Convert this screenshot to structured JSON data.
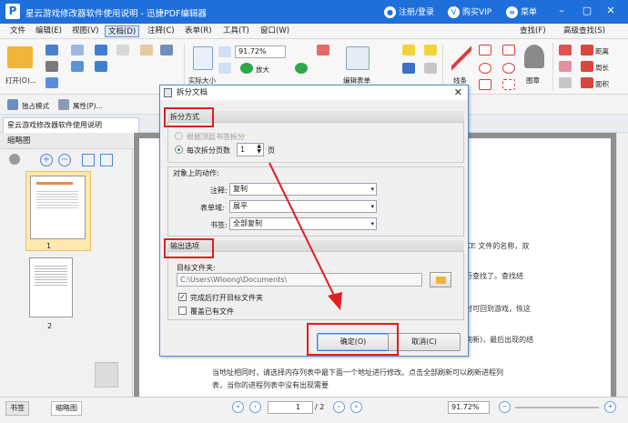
{
  "window": {
    "title": "星云游戏修改器软件使用说明 - 迅捷PDF编辑器",
    "register_label": "注册/登录",
    "buy_label": "购买VIP",
    "menu_label": "菜单"
  },
  "menubar": {
    "items": [
      "文件",
      "编辑(E)",
      "视图(V)",
      "文档(D)",
      "注释(C)",
      "表单(R)",
      "工具(T)",
      "窗口(W)"
    ],
    "active": "文档(D)",
    "right_items": [
      "查找(F)",
      "高级查找(S)"
    ]
  },
  "toolbar": {
    "open_label": "打开(O)...",
    "zoom_value": "91.72%",
    "zoom_in_label": "放大",
    "actual_size_label": "实际大小",
    "edit_form_label": "编辑表单",
    "line_label": "线条",
    "stamp_label": "图章",
    "distance_label": "距离",
    "perimeter_label": "周长",
    "area_label": "面积"
  },
  "toolbar2": {
    "exclusive_mode": "独占模式",
    "properties": "属性(P)..."
  },
  "doc_tab": {
    "label": "星云游戏修改器软件使用说明"
  },
  "left_panel": {
    "title": "缩略图",
    "pages": [
      "1",
      "2"
    ],
    "bottom_tabs": [
      "书签",
      "缩略图"
    ]
  },
  "document": {
    "lines": [
      "KE 文件的名称，双",
      "行查找了。查找结",
      "时可回到游戏，恢这",
      "刷新)，最后出现的结",
      "当地址相同时，请选择内存列表中最下面一个地址进行修改。点击全部刷新可以刷新进程列",
      "表，当你的进程列表中没有出现需要"
    ]
  },
  "statusbar": {
    "page_input": "1",
    "page_total": "/ 2",
    "zoom": "91.72%"
  },
  "dialog": {
    "title": "拆分文档",
    "split_method_header": "拆分方式",
    "option_bookmark": "根据顶层书签拆分",
    "option_pages": "每次拆分页数",
    "pages_value": "1",
    "pages_unit": "页",
    "object_actions_header": "对象上的动作:",
    "annotations_label": "注释:",
    "annotations_value": "复制",
    "form_fields_label": "表单域:",
    "form_fields_value": "展平",
    "bookmarks_label": "书签:",
    "bookmarks_value": "全部复制",
    "output_header": "输出选项",
    "target_folder_label": "目标文件夹:",
    "target_folder_value": "C:\\Users\\Wloong\\Documents\\",
    "open_after_label": "完成后打开目标文件夹",
    "overwrite_label": "覆盖已有文件",
    "ok_label": "确定(O)",
    "cancel_label": "取消(C)"
  },
  "colors": {
    "title_bar": "#1e6fd9",
    "highlight_red": "#e02020",
    "dialog_border": "#5d8ad2"
  }
}
